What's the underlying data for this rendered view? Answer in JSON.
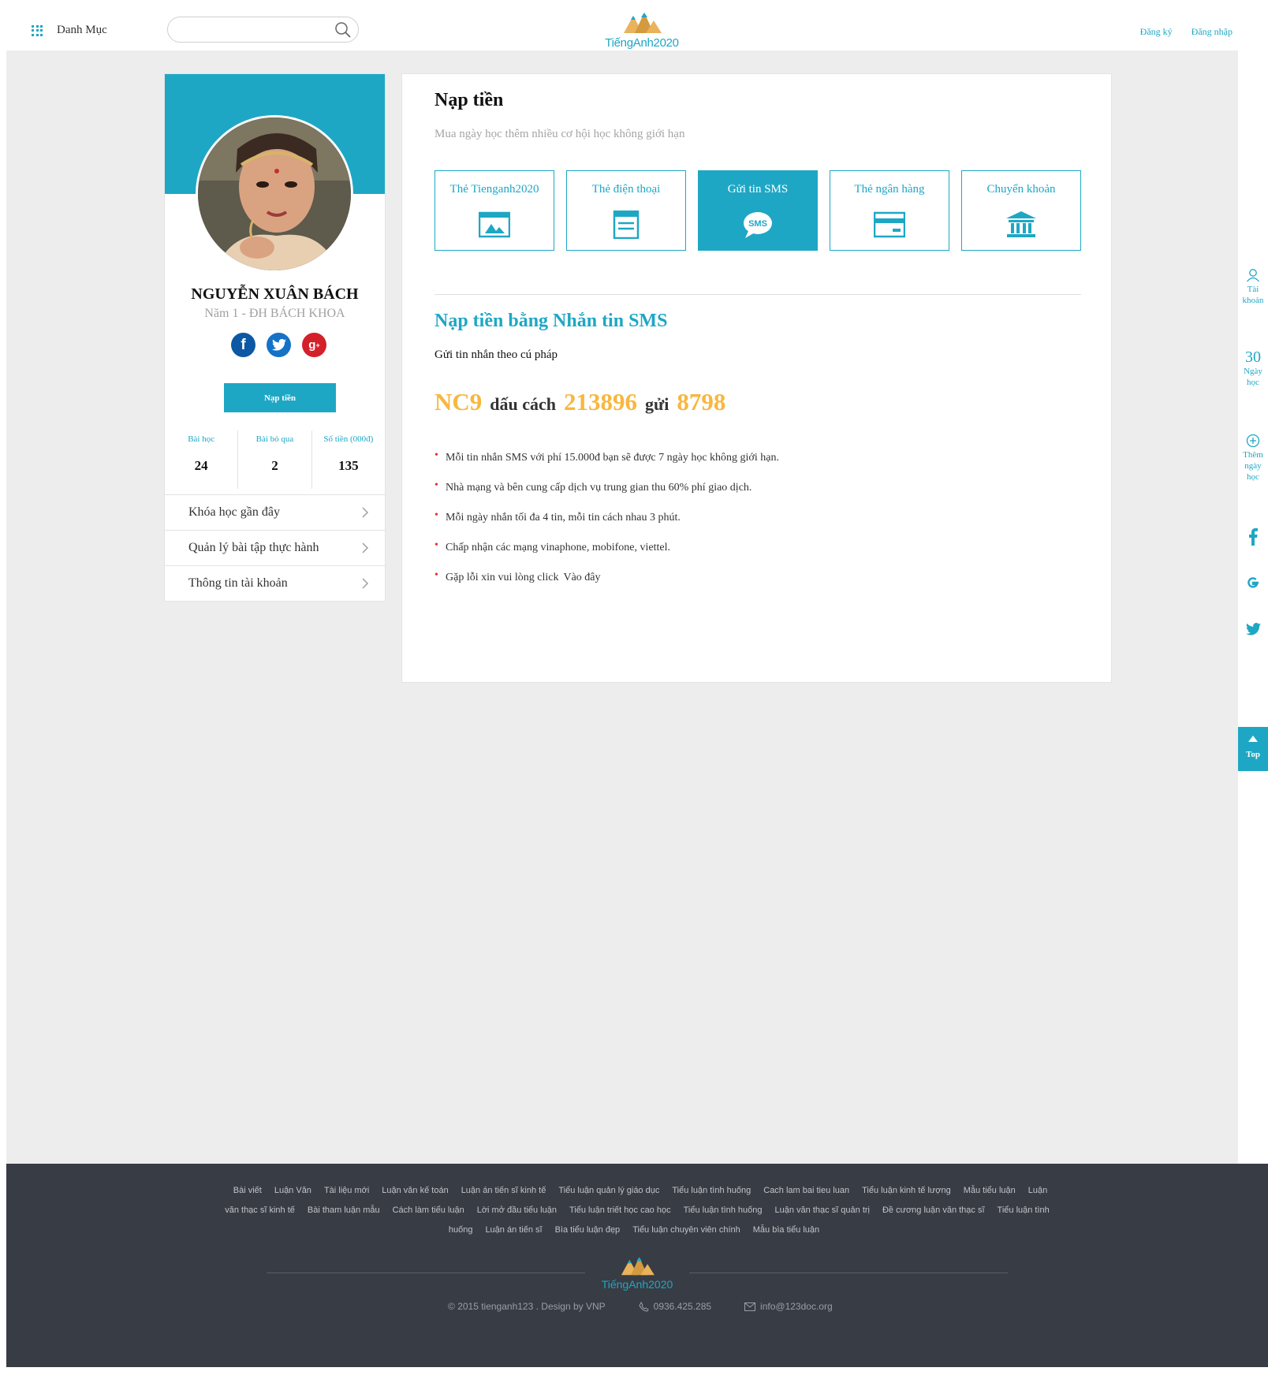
{
  "header": {
    "menu_label": "Danh Mục",
    "search_placeholder": "",
    "logo_text": "TiếngAnh2020",
    "register": "Đăng ký",
    "login": "Đăng nhập"
  },
  "profile": {
    "name": "NGUYỄN XUÂN BÁCH",
    "subtitle": "Năm 1 - ĐH BÁCH KHOA",
    "topup_button": "Nạp tiền",
    "stats": [
      {
        "label": "Bài học",
        "value": "24"
      },
      {
        "label": "Bài bỏ qua",
        "value": "2"
      },
      {
        "label": "Số tiền (000đ)",
        "value": "135"
      }
    ],
    "menu": [
      {
        "label": "Khóa học gần đây"
      },
      {
        "label": "Quản lý bài tập thực hành"
      },
      {
        "label": "Thông tin tài khoản"
      }
    ]
  },
  "main": {
    "title": "Nạp tiền",
    "subtitle": "Mua ngày học thêm nhiều cơ hội học không giới hạn",
    "methods": [
      {
        "label": "Thẻ Tienganh2020",
        "icon": "card-image-icon",
        "active": false
      },
      {
        "label": "Thẻ điện thoại",
        "icon": "phone-card-icon",
        "active": false
      },
      {
        "label": "Gửi tin SMS",
        "icon": "sms-icon",
        "active": true
      },
      {
        "label": "Thẻ ngân hàng",
        "icon": "bank-card-icon",
        "active": false
      },
      {
        "label": "Chuyển khoản",
        "icon": "bank-building-icon",
        "active": false
      }
    ],
    "section_title": "Nạp tiền bằng Nhắn tin SMS",
    "section_sub": "Gửi tin nhắn theo cú pháp",
    "syntax": {
      "code1": "NC9",
      "word1": "dấu cách",
      "code2": "213896",
      "word2": "gửi",
      "code3": "8798"
    },
    "notes": [
      "Mỗi tin nhắn SMS với phí 15.000đ bạn sẽ được 7 ngày học không giới hạn.",
      "Nhà mạng và bên cung cấp dịch vụ trung gian thu 60% phí giao dịch.",
      "Mỗi ngày nhắn tối đa 4 tin, mỗi tin cách nhau 3 phút.",
      "Chấp nhận các mạng vinaphone, mobifone, viettel."
    ],
    "error_note": "Gặp lỗi xin vui lòng click",
    "error_link": "Vào đây",
    "accent_color": "#1ea7c5",
    "code_color": "#f7b73f"
  },
  "float_bar": {
    "account_label": "Tài khoản",
    "days_number": "30",
    "days_label": "Ngày học",
    "add_days_label": "Thêm ngày học",
    "top_label": "Top"
  },
  "footer": {
    "links": [
      "Bài viết",
      "Luận Văn",
      "Tài liệu mới",
      "Luận văn kế toán",
      "Luận án tiến sĩ kinh tế",
      "Tiểu luận quản lý giáo dục",
      "Tiểu luận tình huống",
      "Cach lam bai tieu luan",
      "Tiểu luận kinh tế lượng",
      "Mẫu tiểu luận",
      "Luận văn thạc sĩ kinh tế",
      "Bài tham luận mẫu",
      "Cách làm tiểu luận",
      "Lời mở đầu tiểu luận",
      "Tiểu luận triết học cao học",
      "Tiểu luận tình huống",
      "Luận văn thạc sĩ quản trị",
      "Đề cương luận văn thạc sĩ",
      "Tiểu luận tình huống",
      "Luận án tiến sĩ",
      "Bìa tiểu luận đẹp",
      "Tiểu luận chuyên viên chính",
      "Mẫu bìa tiểu luận"
    ],
    "logo_text": "TiếngAnh2020",
    "copyright": "© 2015  tienganh123 . Design by VNP",
    "phone": "0936.425.285",
    "email": "info@123doc.org"
  }
}
